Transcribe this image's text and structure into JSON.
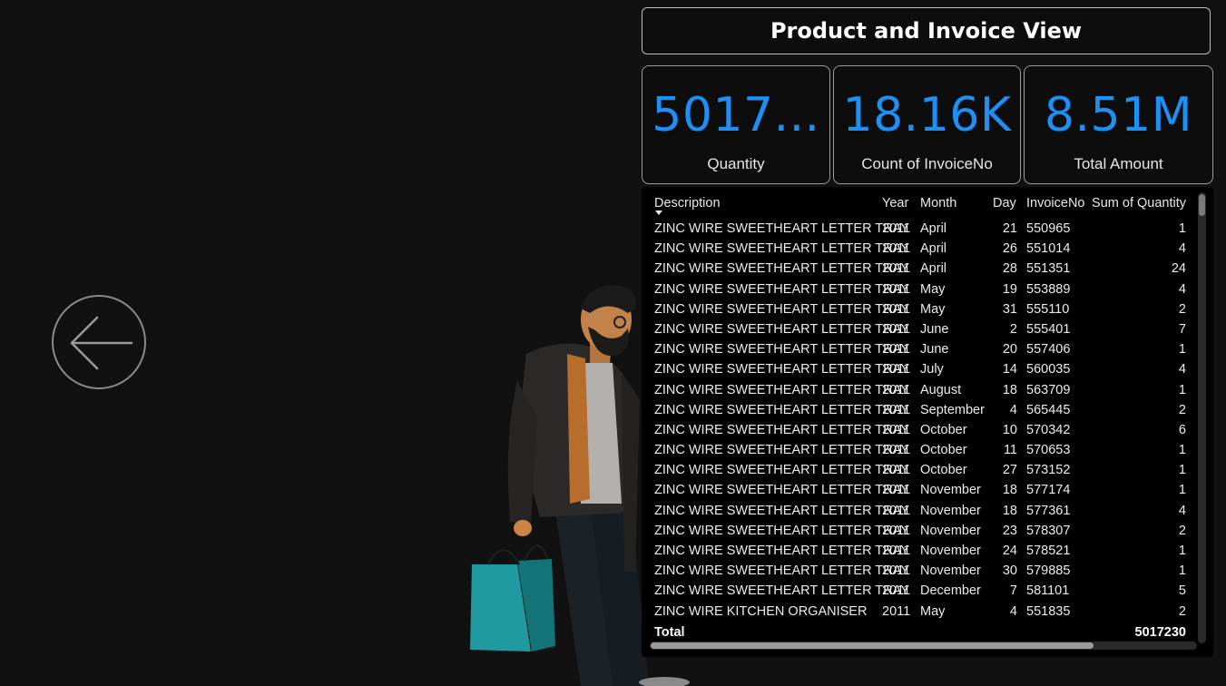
{
  "title": "Product and Invoice View",
  "nav": {
    "back_icon": "arrow-left-circle-icon"
  },
  "kpis": [
    {
      "value": "5017...",
      "label": "Quantity"
    },
    {
      "value": "18.16K",
      "label": "Count of InvoiceNo"
    },
    {
      "value": "8.51M",
      "label": "Total Amount"
    }
  ],
  "colors": {
    "accent": "#1e8ff5",
    "background": "#111111",
    "table_bg": "#000000"
  },
  "table": {
    "columns": [
      "Description",
      "Year",
      "Month",
      "Day",
      "InvoiceNo",
      "Sum of Quantity"
    ],
    "sort": {
      "column": "Description",
      "direction": "descending"
    },
    "rows": [
      [
        "ZINC WIRE SWEETHEART LETTER TRAY",
        "2011",
        "April",
        "21",
        "550965",
        "1"
      ],
      [
        "ZINC WIRE SWEETHEART LETTER TRAY",
        "2011",
        "April",
        "26",
        "551014",
        "4"
      ],
      [
        "ZINC WIRE SWEETHEART LETTER TRAY",
        "2011",
        "April",
        "28",
        "551351",
        "24"
      ],
      [
        "ZINC WIRE SWEETHEART LETTER TRAY",
        "2011",
        "May",
        "19",
        "553889",
        "4"
      ],
      [
        "ZINC WIRE SWEETHEART LETTER TRAY",
        "2011",
        "May",
        "31",
        "555110",
        "2"
      ],
      [
        "ZINC WIRE SWEETHEART LETTER TRAY",
        "2011",
        "June",
        "2",
        "555401",
        "7"
      ],
      [
        "ZINC WIRE SWEETHEART LETTER TRAY",
        "2011",
        "June",
        "20",
        "557406",
        "1"
      ],
      [
        "ZINC WIRE SWEETHEART LETTER TRAY",
        "2011",
        "July",
        "14",
        "560035",
        "4"
      ],
      [
        "ZINC WIRE SWEETHEART LETTER TRAY",
        "2011",
        "August",
        "18",
        "563709",
        "1"
      ],
      [
        "ZINC WIRE SWEETHEART LETTER TRAY",
        "2011",
        "September",
        "4",
        "565445",
        "2"
      ],
      [
        "ZINC WIRE SWEETHEART LETTER TRAY",
        "2011",
        "October",
        "10",
        "570342",
        "6"
      ],
      [
        "ZINC WIRE SWEETHEART LETTER TRAY",
        "2011",
        "October",
        "11",
        "570653",
        "1"
      ],
      [
        "ZINC WIRE SWEETHEART LETTER TRAY",
        "2011",
        "October",
        "27",
        "573152",
        "1"
      ],
      [
        "ZINC WIRE SWEETHEART LETTER TRAY",
        "2011",
        "November",
        "18",
        "577174",
        "1"
      ],
      [
        "ZINC WIRE SWEETHEART LETTER TRAY",
        "2011",
        "November",
        "18",
        "577361",
        "4"
      ],
      [
        "ZINC WIRE SWEETHEART LETTER TRAY",
        "2011",
        "November",
        "23",
        "578307",
        "2"
      ],
      [
        "ZINC WIRE SWEETHEART LETTER TRAY",
        "2011",
        "November",
        "24",
        "578521",
        "1"
      ],
      [
        "ZINC WIRE SWEETHEART LETTER TRAY",
        "2011",
        "November",
        "30",
        "579885",
        "1"
      ],
      [
        "ZINC WIRE SWEETHEART LETTER TRAY",
        "2011",
        "December",
        "7",
        "581101",
        "5"
      ],
      [
        "ZINC WIRE KITCHEN ORGANISER",
        "2011",
        "May",
        "4",
        "551835",
        "2"
      ]
    ],
    "total": {
      "label": "Total",
      "quantity": "5017230"
    }
  }
}
